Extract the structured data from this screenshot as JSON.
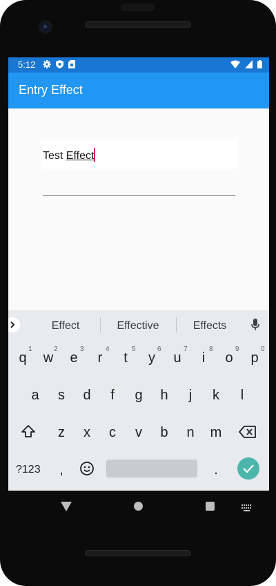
{
  "status_bar": {
    "time": "5:12",
    "icons_left": [
      "gear-icon",
      "shield-icon",
      "sim-card-icon"
    ],
    "icons_right": [
      "wifi-icon",
      "signal-icon",
      "battery-icon"
    ]
  },
  "app_bar": {
    "title": "Entry Effect",
    "color": "#2196f3",
    "status_color": "#1976d2"
  },
  "entry": {
    "text_plain": "Test ",
    "text_composing": "Effect"
  },
  "keyboard": {
    "suggestions": [
      "Effect",
      "Effective",
      "Effects"
    ],
    "row1": [
      {
        "key": "q",
        "hint": "1"
      },
      {
        "key": "w",
        "hint": "2"
      },
      {
        "key": "e",
        "hint": "3"
      },
      {
        "key": "r",
        "hint": "4"
      },
      {
        "key": "t",
        "hint": "5"
      },
      {
        "key": "y",
        "hint": "6"
      },
      {
        "key": "u",
        "hint": "7"
      },
      {
        "key": "i",
        "hint": "8"
      },
      {
        "key": "o",
        "hint": "9"
      },
      {
        "key": "p",
        "hint": "0"
      }
    ],
    "row2": [
      "a",
      "s",
      "d",
      "f",
      "g",
      "h",
      "j",
      "k",
      "l"
    ],
    "row3": [
      "z",
      "x",
      "c",
      "v",
      "b",
      "n",
      "m"
    ],
    "symbols_label": "?123",
    "comma": ",",
    "period": ".",
    "accent": "#4db6ac"
  },
  "nav_bar": {
    "icons": [
      "back-icon",
      "home-icon",
      "recents-icon",
      "keyboard-icon"
    ]
  }
}
